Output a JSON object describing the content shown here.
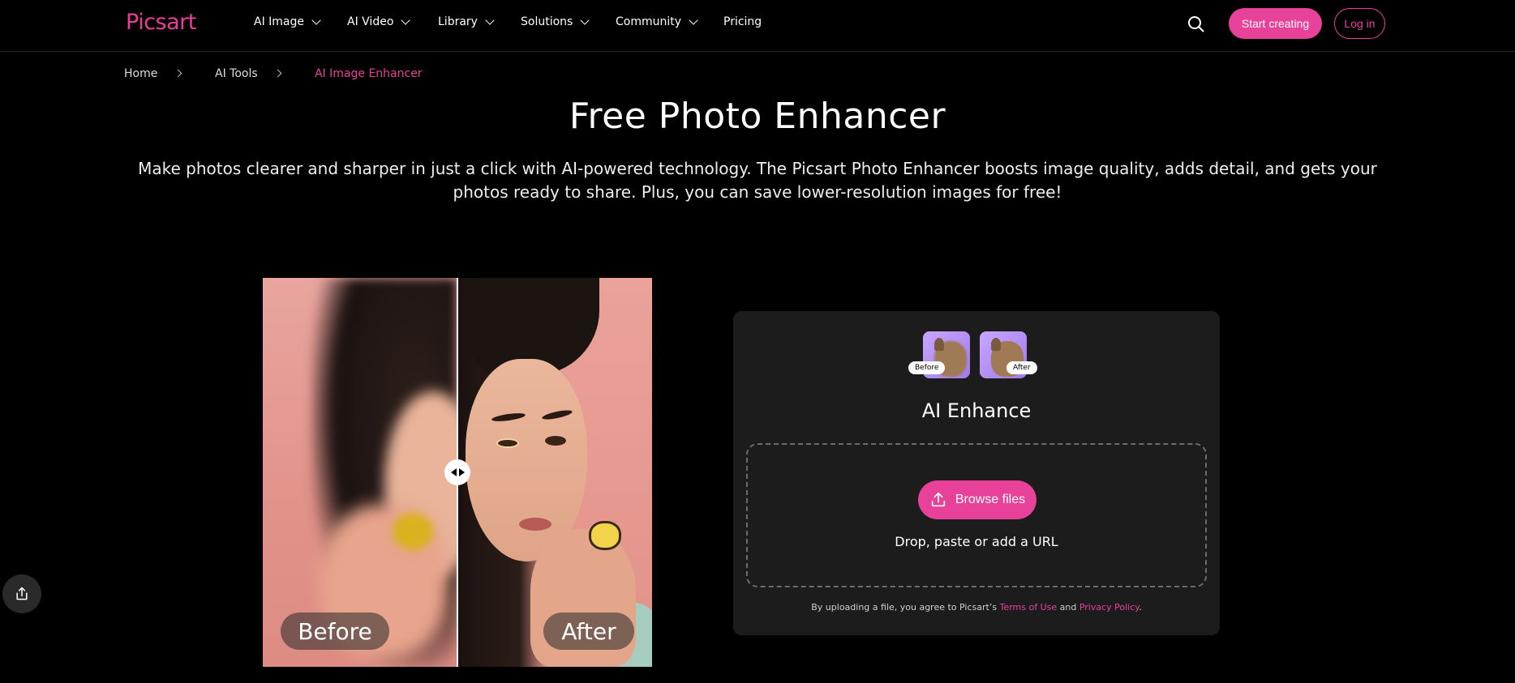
{
  "brand": {
    "logo_text": "Picsart",
    "accent": "#e8419a"
  },
  "nav": {
    "items": [
      {
        "label": "AI Image"
      },
      {
        "label": "AI Video"
      },
      {
        "label": "Library"
      },
      {
        "label": "Solutions"
      },
      {
        "label": "Community"
      },
      {
        "label": "Pricing"
      }
    ],
    "start_label": "Start creating",
    "login_label": "Log in"
  },
  "breadcrumb": [
    {
      "label": "Home"
    },
    {
      "label": "AI Tools"
    },
    {
      "label": "AI Image Enhancer"
    }
  ],
  "hero": {
    "title": "Free Photo Enhancer",
    "subtitle": "Make photos clearer and sharper in just a click with AI-powered technology. The Picsart Photo Enhancer boosts image quality, adds detail, and gets your photos ready to share. Plus, you can save lower-resolution images for free!"
  },
  "compare": {
    "before_label": "Before",
    "after_label": "After"
  },
  "upload": {
    "thumb_before_label": "Before",
    "thumb_after_label": "After",
    "title": "AI Enhance",
    "browse_label": "Browse files",
    "drop_text": "Drop, paste or add a URL",
    "legal_prefix": "By uploading a file, you agree to Picsart’s",
    "terms_label": "Terms of Use",
    "legal_and": "and",
    "privacy_label": "Privacy Policy",
    "legal_suffix": "."
  }
}
